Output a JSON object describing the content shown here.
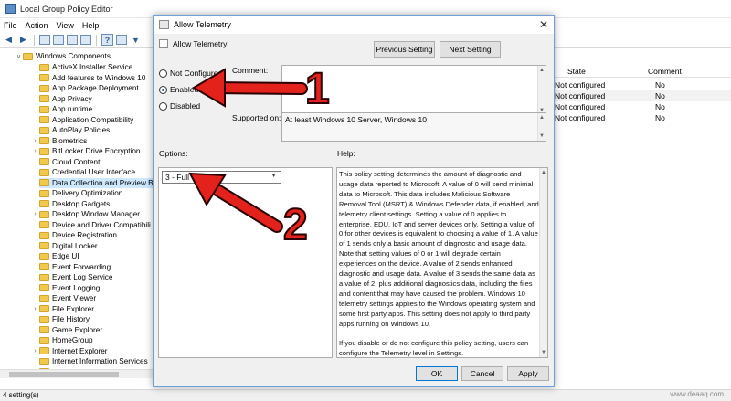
{
  "app": {
    "title": "Local Group Policy Editor",
    "menu": [
      "File",
      "Action",
      "View",
      "Help"
    ],
    "status": "4 setting(s)"
  },
  "tree": {
    "root_label": "Windows Components",
    "items": [
      "ActiveX Installer Service",
      "Add features to Windows 10",
      "App Package Deployment",
      "App Privacy",
      "App runtime",
      "Application Compatibility",
      "AutoPlay Policies",
      "Biometrics",
      "BitLocker Drive Encryption",
      "Cloud Content",
      "Credential User Interface",
      "Data Collection and Preview B",
      "Delivery Optimization",
      "Desktop Gadgets",
      "Desktop Window Manager",
      "Device and Driver Compatibili",
      "Device Registration",
      "Digital Locker",
      "Edge UI",
      "Event Forwarding",
      "Event Log Service",
      "Event Logging",
      "Event Viewer",
      "File Explorer",
      "File History",
      "Game Explorer",
      "HomeGroup",
      "Internet Explorer",
      "Internet Information Services",
      "Location and Sensors"
    ],
    "expandable": [
      7,
      8,
      14,
      23,
      27,
      29
    ]
  },
  "list": {
    "headers": [
      "State",
      "Comment"
    ],
    "rows": [
      {
        "state": "Not configured",
        "comment": "No"
      },
      {
        "state": "Not configured",
        "comment": "No"
      },
      {
        "state": "Not configured",
        "comment": "No"
      },
      {
        "state": "Not configured",
        "comment": "No"
      }
    ]
  },
  "dialog": {
    "title": "Allow Telemetry",
    "subtitle": "Allow Telemetry",
    "prev_label": "Previous Setting",
    "next_label": "Next Setting",
    "radio_not_configured": "Not Configured",
    "radio_enabled": "Enabled",
    "radio_disabled": "Disabled",
    "comment_label": "Comment:",
    "supported_label": "Supported on:",
    "supported_value": "At least Windows 10 Server, Windows 10",
    "options_label": "Options:",
    "help_label": "Help:",
    "telemetry_value": "3 - Full",
    "help_text": "This policy setting determines the amount of diagnostic and usage data reported to Microsoft. A value of 0 will send minimal data to Microsoft. This data includes Malicious Software Removal Tool (MSRT) & Windows Defender data, if enabled, and telemetry client settings. Setting a value of 0 applies to enterprise, EDU, IoT and server devices only. Setting a value of 0 for other devices is equivalent to choosing a value of 1. A value of 1 sends only a basic amount of diagnostic and usage data. Note that setting values of 0 or 1 will degrade certain experiences on the device. A value of 2 sends enhanced diagnostic and usage data. A value of 3 sends the same data as a value of 2, plus additional diagnostics data, including the files and content that may have caused the problem. Windows 10 telemetry settings applies to the Windows operating system and some first party apps. This setting does not apply to third party apps running on Windows 10.\n\nIf you disable or do not configure this policy setting, users can configure the Telemetry level in Settings.",
    "ok_label": "OK",
    "cancel_label": "Cancel",
    "apply_label": "Apply"
  },
  "annotations": {
    "arrow1_label": "1",
    "arrow2_label": "2",
    "color": "#e3231b"
  },
  "watermark": "www.deaaq.com"
}
